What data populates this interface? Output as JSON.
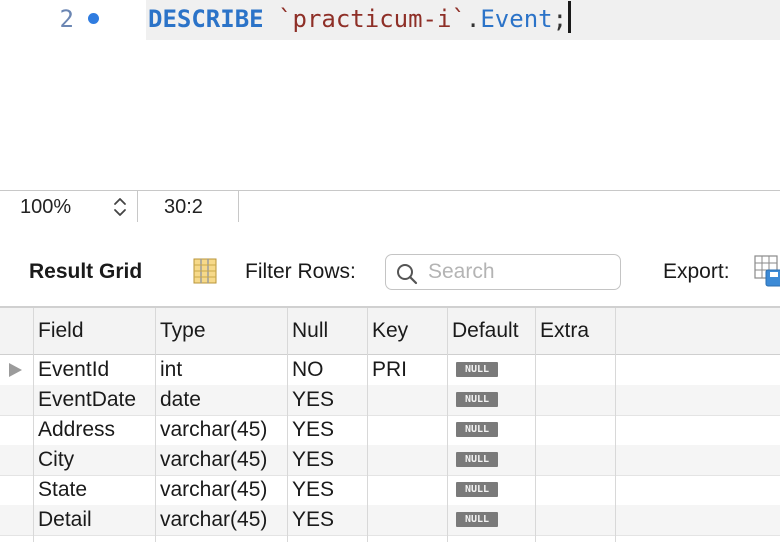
{
  "editor": {
    "line_number": "2",
    "code": {
      "keyword": "DESCRIBE",
      "schema": "`practicum-i`",
      "dot": ".",
      "table": "Event",
      "terminator": ";"
    }
  },
  "statusbar": {
    "zoom": "100%",
    "cursor_position": "30:2"
  },
  "toolbar": {
    "title": "Result Grid",
    "filter_label": "Filter Rows:",
    "search_placeholder": "Search",
    "export_label": "Export:"
  },
  "grid": {
    "columns": [
      "Field",
      "Type",
      "Null",
      "Key",
      "Default",
      "Extra"
    ],
    "rows": [
      [
        "EventId",
        "int",
        "NO",
        "PRI",
        "NULL",
        ""
      ],
      [
        "EventDate",
        "date",
        "YES",
        "",
        "NULL",
        ""
      ],
      [
        "Address",
        "varchar(45)",
        "YES",
        "",
        "NULL",
        ""
      ],
      [
        "City",
        "varchar(45)",
        "YES",
        "",
        "NULL",
        ""
      ],
      [
        "State",
        "varchar(45)",
        "YES",
        "",
        "NULL",
        ""
      ],
      [
        "Detail",
        "varchar(45)",
        "YES",
        "",
        "NULL",
        ""
      ]
    ]
  },
  "colors": {
    "keyword": "#2b73c8",
    "string": "#8e2f27",
    "breakpoint": "#2f7ce0",
    "null_badge": "#7a7a7a"
  },
  "icons": [
    "breakpoint-dot",
    "stepper-icon",
    "result-grid-icon",
    "search-icon",
    "export-icon",
    "current-row-arrow-icon"
  ]
}
